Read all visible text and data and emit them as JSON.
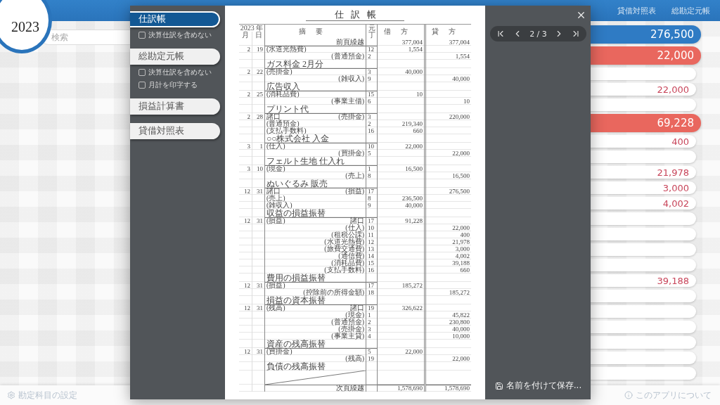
{
  "app": {
    "year": "2023",
    "header_links": [
      "貸借対照表",
      "総勘定元帳"
    ],
    "search": {
      "placeholder": "検索"
    },
    "amounts": [
      {
        "kind": "total",
        "color": "#2f7bc4",
        "amount": "276,500"
      },
      {
        "kind": "total",
        "color": "#e9675e",
        "amount": "22,000"
      },
      {
        "kind": "item"
      },
      {
        "kind": "item",
        "amount": "22,000"
      },
      {
        "kind": "item"
      },
      {
        "kind": "total",
        "color": "#e9675e",
        "amount": "69,228"
      },
      {
        "kind": "item",
        "amount": "400"
      },
      {
        "kind": "item"
      },
      {
        "kind": "item",
        "amount": "21,978"
      },
      {
        "kind": "item",
        "amount": "3,000"
      },
      {
        "kind": "item",
        "amount": "4,002"
      },
      {
        "kind": "item"
      },
      {
        "kind": "item"
      },
      {
        "kind": "item"
      },
      {
        "kind": "item"
      },
      {
        "kind": "item",
        "amount": "39,188"
      },
      {
        "kind": "item"
      },
      {
        "kind": "item"
      },
      {
        "kind": "item"
      },
      {
        "kind": "item"
      },
      {
        "kind": "item"
      },
      {
        "kind": "item"
      }
    ],
    "footer": {
      "settings": "勘定科目の設定",
      "about": "このアプリについて"
    }
  },
  "print_dialog": {
    "reports": [
      {
        "label": "仕訳帳",
        "selected": true,
        "options": [
          {
            "label": "決算仕訳を含めない",
            "checked": false
          }
        ]
      },
      {
        "label": "総勘定元帳",
        "selected": false,
        "options": [
          {
            "label": "決算仕訳を含めない",
            "checked": false
          },
          {
            "label": "月計を印字する",
            "checked": false
          }
        ]
      },
      {
        "label": "損益計算書",
        "selected": false
      },
      {
        "label": "貸借対照表",
        "selected": false
      }
    ],
    "page": {
      "title": "仕訳帳",
      "header": {
        "year": "2023",
        "year_unit": "年",
        "month": "月",
        "day": "日",
        "description": "摘要",
        "ref": "元丁",
        "debit": "借方",
        "credit": "貸方"
      },
      "rows": [
        {
          "kind": "line",
          "right": "前頁繰越",
          "debit": "377,004",
          "credit": "377,004"
        },
        {
          "kind": "line",
          "month": "2",
          "day": "19",
          "left": "(水道光熱費)",
          "ref": "12",
          "debit": "1,554"
        },
        {
          "kind": "line",
          "right": "(普通預金)",
          "ref": "2",
          "credit": "1,554"
        },
        {
          "kind": "memo",
          "text": "ガス料金 2月分"
        },
        {
          "kind": "line",
          "month": "2",
          "day": "22",
          "left": "(売掛金)",
          "ref": "3",
          "debit": "40,000"
        },
        {
          "kind": "line",
          "right": "(雑収入)",
          "ref": "9",
          "credit": "40,000"
        },
        {
          "kind": "memo",
          "text": "広告収入"
        },
        {
          "kind": "line",
          "month": "2",
          "day": "25",
          "left": "(消耗品費)",
          "ref": "15",
          "debit": "10"
        },
        {
          "kind": "line",
          "right": "(事業主借)",
          "ref": "6",
          "credit": "10"
        },
        {
          "kind": "memo",
          "text": "プリント代"
        },
        {
          "kind": "line",
          "month": "2",
          "day": "28",
          "left": "諸口",
          "right": "(売掛金)",
          "ref": "3",
          "credit": "220,000"
        },
        {
          "kind": "line",
          "left": "(普通預金)",
          "ref": "2",
          "debit": "219,340"
        },
        {
          "kind": "line",
          "left": "(支払手数料)",
          "ref": "16",
          "debit": "660"
        },
        {
          "kind": "memo",
          "text": "○○株式会社 入金"
        },
        {
          "kind": "line",
          "month": "3",
          "day": "1",
          "left": "(仕入)",
          "ref": "10",
          "debit": "22,000"
        },
        {
          "kind": "line",
          "right": "(買掛金)",
          "ref": "5",
          "credit": "22,000"
        },
        {
          "kind": "memo",
          "text": "フェルト生地 仕入れ"
        },
        {
          "kind": "line",
          "month": "3",
          "day": "10",
          "left": "(現金)",
          "ref": "1",
          "debit": "16,500"
        },
        {
          "kind": "line",
          "right": "(売上)",
          "ref": "8",
          "credit": "16,500"
        },
        {
          "kind": "memo",
          "text": "ぬいぐるみ 販売"
        },
        {
          "kind": "line",
          "month": "12",
          "day": "31",
          "left": "諸口",
          "right": "(損益)",
          "ref": "17",
          "credit": "276,500"
        },
        {
          "kind": "line",
          "left": "(売上)",
          "ref": "8",
          "debit": "236,500"
        },
        {
          "kind": "line",
          "left": "(雑収入)",
          "ref": "9",
          "debit": "40,000"
        },
        {
          "kind": "memo",
          "text": "収益の損益振替"
        },
        {
          "kind": "line",
          "month": "12",
          "day": "31",
          "left": "(損益)",
          "right": "諸口",
          "ref": "17",
          "debit": "91,228"
        },
        {
          "kind": "line",
          "right": "(仕入)",
          "ref": "10",
          "credit": "22,000"
        },
        {
          "kind": "line",
          "right": "(租税公課)",
          "ref": "11",
          "credit": "400"
        },
        {
          "kind": "line",
          "right": "(水道光熱費)",
          "ref": "12",
          "credit": "21,978"
        },
        {
          "kind": "line",
          "right": "(旅費交通費)",
          "ref": "13",
          "credit": "3,000"
        },
        {
          "kind": "line",
          "right": "(通信費)",
          "ref": "14",
          "credit": "4,002"
        },
        {
          "kind": "line",
          "right": "(消耗品費)",
          "ref": "15",
          "credit": "39,188"
        },
        {
          "kind": "line",
          "right": "(支払手数料)",
          "ref": "16",
          "credit": "660"
        },
        {
          "kind": "memo",
          "text": "費用の損益振替"
        },
        {
          "kind": "line",
          "month": "12",
          "day": "31",
          "left": "(損益)",
          "ref": "17",
          "debit": "185,272"
        },
        {
          "kind": "line",
          "right": "(控除前の所得金額)",
          "ref": "18",
          "credit": "185,272"
        },
        {
          "kind": "memo",
          "text": "損益の資本振替"
        },
        {
          "kind": "line",
          "month": "12",
          "day": "31",
          "left": "(残高)",
          "right": "諸口",
          "ref": "19",
          "debit": "326,622"
        },
        {
          "kind": "line",
          "right": "(現金)",
          "ref": "1",
          "credit": "45,822"
        },
        {
          "kind": "line",
          "right": "(普通預金)",
          "ref": "2",
          "credit": "230,800"
        },
        {
          "kind": "line",
          "right": "(売掛金)",
          "ref": "3",
          "credit": "40,000"
        },
        {
          "kind": "line",
          "right": "(事業主貸)",
          "ref": "4",
          "credit": "10,000"
        },
        {
          "kind": "memo",
          "text": "資産の残高振替"
        },
        {
          "kind": "line",
          "month": "12",
          "day": "31",
          "left": "(買掛金)",
          "ref": "5",
          "debit": "22,000"
        },
        {
          "kind": "line",
          "right": "(残高)",
          "ref": "19",
          "credit": "22,000"
        },
        {
          "kind": "memo",
          "text": "負債の残高振替"
        },
        {
          "kind": "blank"
        },
        {
          "kind": "total",
          "right": "次頁繰越",
          "debit": "1,578,690",
          "credit": "1,578,690"
        }
      ]
    },
    "pager": "2 / 3",
    "save": "名前を付けて保存..."
  }
}
